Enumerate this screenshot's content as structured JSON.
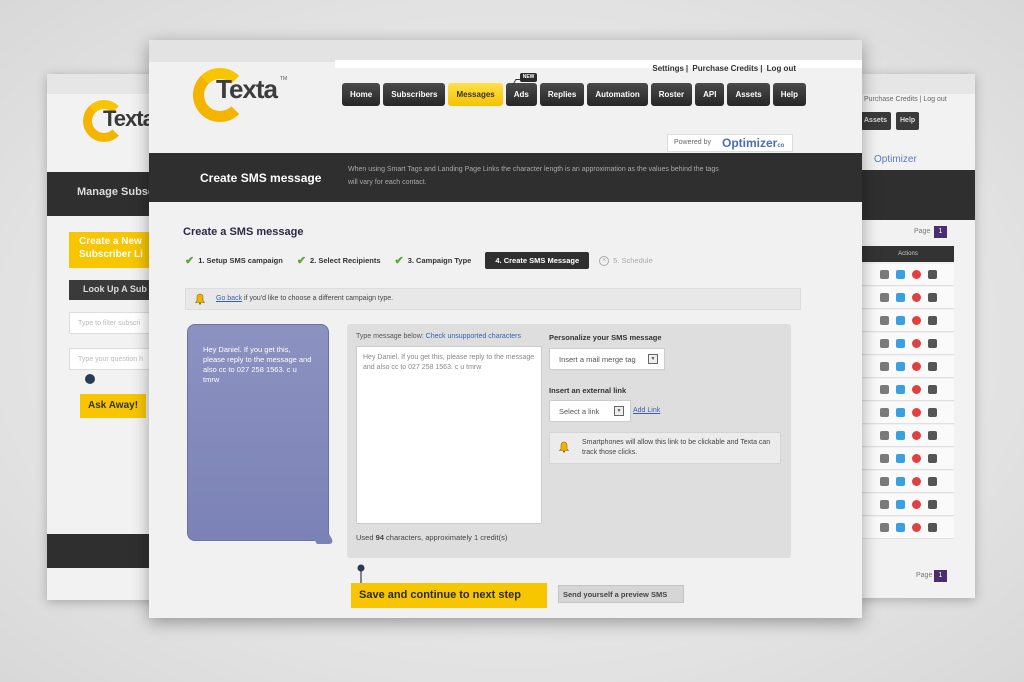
{
  "left_card": {
    "logo": "Texta",
    "band_title": "Manage Subsc",
    "create_button": "Create a New Subscriber Li",
    "lookup_button": "Look Up A Sub",
    "filter_placeholder": "Type to filter subscri",
    "question_placeholder": "Type your question h",
    "ask_button": "Ask Away!"
  },
  "right_card": {
    "top_links": "Purchase Credits | Log out",
    "buttons": [
      "Assets",
      "Help"
    ],
    "powered": "Optimizer",
    "page_label": "Page",
    "page_number": "1",
    "actions_header": "Actions",
    "row_count": 12
  },
  "top_links": [
    "Settings",
    "Purchase Credits",
    "Log out"
  ],
  "logo": {
    "text": "Texta",
    "tm": "TM"
  },
  "nav": {
    "tabs": [
      {
        "label": "Home",
        "active": false
      },
      {
        "label": "Subscribers",
        "active": false
      },
      {
        "label": "Messages",
        "active": true
      },
      {
        "label": "Ads",
        "active": false,
        "badge": "NEW"
      },
      {
        "label": "Replies",
        "active": false
      },
      {
        "label": "Automation",
        "active": false
      },
      {
        "label": "Roster",
        "active": false
      },
      {
        "label": "API",
        "active": false
      },
      {
        "label": "Assets",
        "active": false
      },
      {
        "label": "Help",
        "active": false
      }
    ]
  },
  "powered": {
    "prefix": "Powered by",
    "brand": "Optimizer",
    "suffix": "co"
  },
  "header": {
    "title": "Create SMS message",
    "note": "When using Smart Tags and Landing Page Links the character length is an approximation as the values behind the tags will vary for each contact."
  },
  "content": {
    "title": "Create a SMS message",
    "steps": [
      {
        "label": "1. Setup SMS campaign",
        "state": "done"
      },
      {
        "label": "2. Select Recipients",
        "state": "done"
      },
      {
        "label": "3. Campaign Type",
        "state": "done"
      },
      {
        "label": "4. Create SMS Message",
        "state": "current"
      },
      {
        "label": "5. Schedule",
        "state": "future"
      }
    ],
    "notice_link": "Go back",
    "notice_text": " if you'd like to choose a different campaign type."
  },
  "phone_preview": "Hey Daniel. If you get this, please reply to the message and also cc to 027 258 1563. c u tmrw",
  "composer": {
    "label": "Type message below:",
    "check_link": "Check unsupported characters",
    "message": "Hey Daniel. If you get this, please reply to the message and also cc to 027 258 1563. c u tmrw",
    "used_prefix": "Used ",
    "used_count": "94",
    "used_suffix": " characters, approximately 1 credit(s)",
    "personalize_heading": "Personalize your SMS message",
    "merge_tag_select": "Insert a mail merge tag",
    "external_link_heading": "Insert an external link",
    "link_select": "Select a link",
    "add_link": "Add Link",
    "tip": "Smartphones will allow this link to be clickable and Texta can track those clicks."
  },
  "actions": {
    "save": "Save and continue to next step",
    "preview": "Send yourself a preview SMS"
  },
  "colors": {
    "accent_yellow": "#f7c600",
    "dark_band": "#2f2f2f",
    "phone_bubble": "#7b82b6",
    "link_blue": "#3b5fae",
    "check_green": "#5aa62e"
  }
}
